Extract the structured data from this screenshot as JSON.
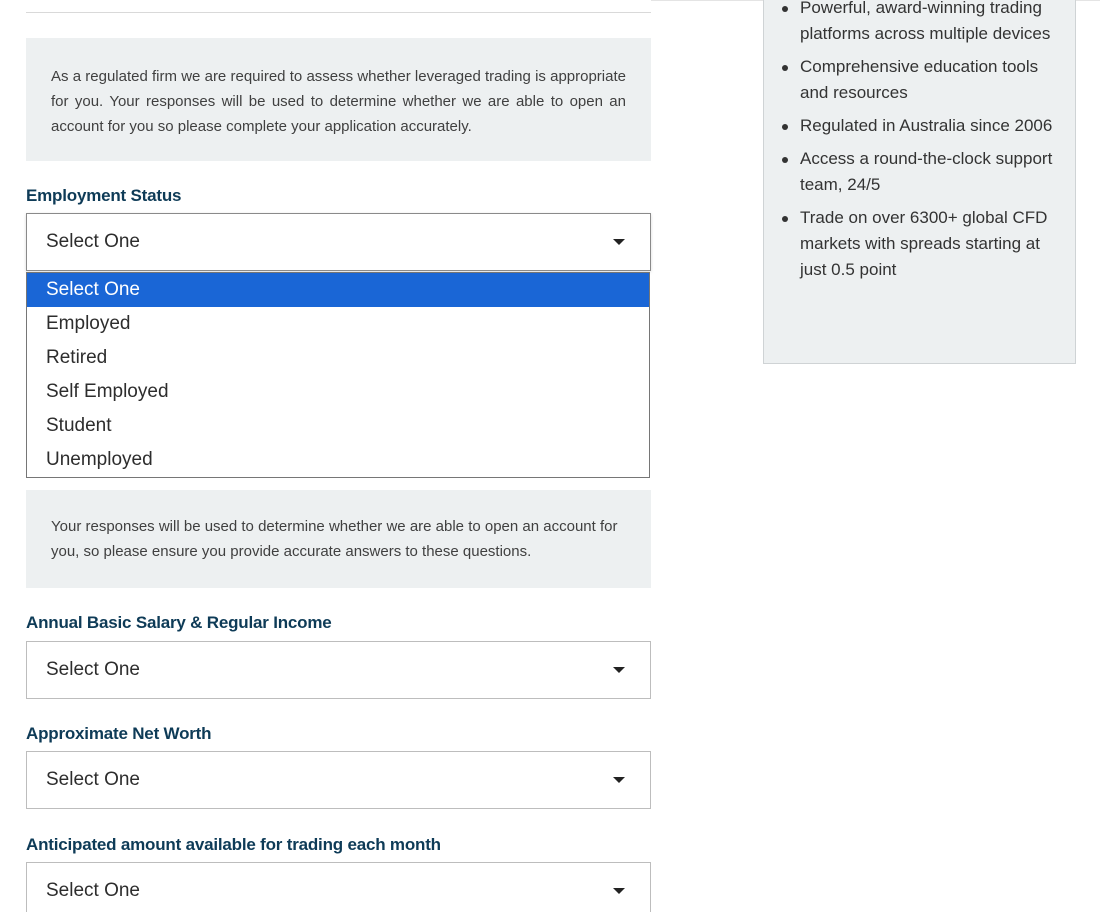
{
  "notices": {
    "assessment": "As a regulated firm we are required to assess whether leveraged trading is appropriate for you. Your responses will be used to determine whether we are able to open an account for you so please complete your application accurately.",
    "accuracy": "Your responses will be used to determine whether we are able to open an account for you, so please ensure you provide accurate answers to these questions."
  },
  "fields": {
    "employment_status": {
      "label": "Employment Status",
      "value": "Select One",
      "options": [
        "Select One",
        "Employed",
        "Retired",
        "Self Employed",
        "Student",
        "Unemployed"
      ],
      "highlighted_option": "Select One"
    },
    "annual_income": {
      "label": "Annual Basic Salary & Regular Income",
      "value": "Select One"
    },
    "net_worth": {
      "label": "Approximate Net Worth",
      "value": "Select One"
    },
    "monthly_trading_amount": {
      "label": "Anticipated amount available for trading each month",
      "value": "Select One"
    }
  },
  "sidebar": {
    "benefits": [
      "Powerful, award-winning trading platforms across multiple devices",
      "Comprehensive education tools and resources",
      "Regulated in Australia since 2006",
      "Access a round-the-clock support team, 24/5",
      "Trade on over 6300+ global CFD markets with spreads starting at just 0.5 point"
    ]
  },
  "colors": {
    "label_text": "#0e3b57",
    "panel_background": "#edf0f1",
    "option_highlight": "#1a66d6"
  },
  "icons": {
    "select_caret": "caret-down-icon",
    "list_bullet": "bullet-icon"
  }
}
